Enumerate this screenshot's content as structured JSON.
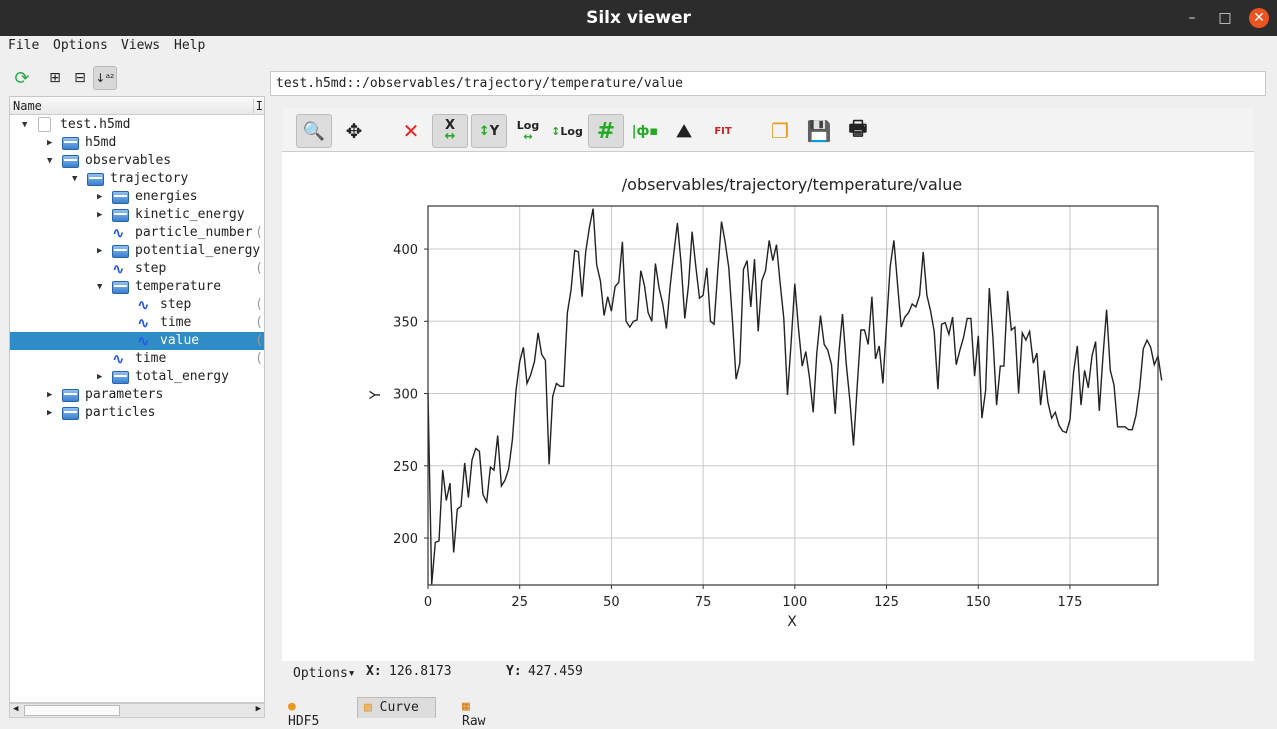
{
  "window": {
    "title": "Silx viewer"
  },
  "menu": [
    "File",
    "Options",
    "Views",
    "Help"
  ],
  "tree": {
    "header": "Name",
    "header2": "I",
    "rows": [
      {
        "label": "test.h5md",
        "level": 0,
        "type": "file",
        "expanded": true
      },
      {
        "label": "h5md",
        "level": 1,
        "type": "group",
        "expanded": false
      },
      {
        "label": "observables",
        "level": 1,
        "type": "group",
        "expanded": true
      },
      {
        "label": "trajectory",
        "level": 2,
        "type": "group",
        "expanded": true
      },
      {
        "label": "energies",
        "level": 3,
        "type": "group",
        "expanded": false
      },
      {
        "label": "kinetic_energy",
        "level": 3,
        "type": "group",
        "expanded": false
      },
      {
        "label": "particle_number",
        "level": 3,
        "type": "dataset"
      },
      {
        "label": "potential_energy",
        "level": 3,
        "type": "group",
        "expanded": false
      },
      {
        "label": "step",
        "level": 3,
        "type": "dataset"
      },
      {
        "label": "temperature",
        "level": 3,
        "type": "group",
        "expanded": true
      },
      {
        "label": "step",
        "level": 4,
        "type": "dataset"
      },
      {
        "label": "time",
        "level": 4,
        "type": "dataset"
      },
      {
        "label": "value",
        "level": 4,
        "type": "dataset",
        "selected": true
      },
      {
        "label": "time",
        "level": 3,
        "type": "dataset"
      },
      {
        "label": "total_energy",
        "level": 3,
        "type": "group",
        "expanded": false
      },
      {
        "label": "parameters",
        "level": 1,
        "type": "group",
        "expanded": false
      },
      {
        "label": "particles",
        "level": 1,
        "type": "group",
        "expanded": false
      }
    ]
  },
  "path": "test.h5md::/observables/trajectory/temperature/value",
  "plot_toolbar": {
    "log_label": "Log",
    "fit_label": "FIT",
    "x_label": "X",
    "y_label": "Y"
  },
  "status": {
    "options": "Options",
    "x_label": "X:",
    "x_value": "126.8173",
    "y_label": "Y:",
    "y_value": "427.459"
  },
  "tabs": [
    {
      "label": "HDF5",
      "active": false
    },
    {
      "label": "Curve",
      "active": true
    },
    {
      "label": "Raw",
      "active": false
    }
  ],
  "colors": {
    "selection": "#308cc6",
    "curve": "#222222",
    "grid": "#c8c8c8",
    "accent": "#e95420"
  },
  "chart_data": {
    "type": "line",
    "title": "/observables/trajectory/temperature/value",
    "xlabel": "X",
    "ylabel": "Y",
    "xlim": [
      0,
      199
    ],
    "ylim": [
      167.5,
      429.8
    ],
    "grid": true,
    "xticks": [
      0,
      25,
      50,
      75,
      100,
      125,
      150,
      175
    ],
    "yticks": [
      200,
      250,
      300,
      350,
      400
    ],
    "y": [
      300,
      168,
      197,
      198,
      247,
      226,
      238,
      190,
      220,
      222,
      252,
      228,
      254,
      262,
      260,
      230,
      225,
      249,
      247,
      271,
      236,
      240,
      248,
      268,
      302,
      322,
      332,
      307,
      313,
      322,
      342,
      327,
      323,
      251,
      298,
      307,
      305,
      305,
      356,
      372,
      399,
      398,
      367,
      398,
      415,
      428,
      389,
      378,
      354,
      367,
      357,
      374,
      377,
      405,
      350,
      346,
      350,
      351,
      385,
      375,
      356,
      350,
      390,
      373,
      362,
      345,
      374,
      397,
      418,
      390,
      352,
      375,
      412,
      388,
      366,
      368,
      387,
      350,
      348,
      385,
      419,
      405,
      387,
      350,
      310,
      321,
      386,
      392,
      360,
      393,
      343,
      378,
      385,
      406,
      392,
      403,
      376,
      352,
      299,
      336,
      376,
      345,
      319,
      329,
      311,
      287,
      328,
      354,
      334,
      330,
      320,
      286,
      328,
      355,
      321,
      295,
      264,
      305,
      344,
      344,
      334,
      367,
      324,
      333,
      307,
      348,
      388,
      406,
      376,
      346,
      353,
      356,
      362,
      360,
      368,
      398,
      368,
      357,
      343,
      303,
      348,
      349,
      341,
      353,
      320,
      330,
      339,
      352,
      352,
      312,
      340,
      283,
      302,
      373,
      339,
      292,
      319,
      319,
      371,
      344,
      346,
      300,
      342,
      337,
      343,
      321,
      328,
      292,
      316,
      294,
      283,
      287,
      278,
      274,
      273,
      282,
      315,
      333,
      292,
      316,
      304,
      326,
      336,
      288,
      326,
      358,
      316,
      306,
      277,
      277,
      277,
      275,
      275,
      285,
      304,
      331,
      337,
      332,
      320,
      326,
      309
    ]
  }
}
